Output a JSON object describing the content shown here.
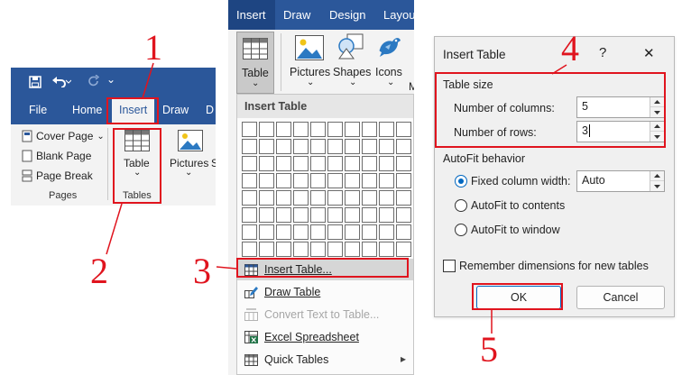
{
  "panel1": {
    "tabs": [
      "File",
      "Home",
      "Insert",
      "Draw",
      "D"
    ],
    "pages_group": {
      "items": [
        "Cover Page",
        "Blank Page",
        "Page Break"
      ],
      "label": "Pages",
      "chevron": "⌄"
    },
    "tables_group": {
      "button": "Table",
      "chevron": "⌄",
      "label": "Tables"
    },
    "pictures_button": "Pictures",
    "clipped_text": "S"
  },
  "panel2": {
    "tabs": [
      "Insert",
      "Draw",
      "Design",
      "Layout"
    ],
    "ribbon": {
      "table": "Table",
      "pictures": "Pictures",
      "shapes": "Shapes",
      "icons": "Icons",
      "clipped": "M",
      "chevron": "⌄"
    },
    "menu": {
      "title": "Insert Table",
      "grid": {
        "columns": 10,
        "rows": 8
      },
      "items": [
        {
          "label": "Insert Table...",
          "highlighted": true,
          "disabled": false,
          "icon": "table-icon"
        },
        {
          "label": "Draw Table",
          "highlighted": false,
          "disabled": false,
          "icon": "pencil-icon"
        },
        {
          "label": "Convert Text to Table...",
          "highlighted": false,
          "disabled": true,
          "icon": "convert-icon"
        },
        {
          "label": "Excel Spreadsheet",
          "highlighted": false,
          "disabled": false,
          "icon": "excel-icon"
        },
        {
          "label": "Quick Tables",
          "highlighted": false,
          "disabled": false,
          "icon": "quick-tables-icon",
          "submenu_arrow": "▸"
        }
      ]
    }
  },
  "dialog": {
    "title": "Insert Table",
    "help": "?",
    "close": "✕",
    "table_size": {
      "heading": "Table size",
      "columns_label": "Number of columns:",
      "columns_value": "5",
      "rows_label": "Number of rows:",
      "rows_value": "3"
    },
    "autofit": {
      "heading": "AutoFit behavior",
      "fixed_label": "Fixed column width:",
      "fixed_value": "Auto",
      "contents_label": "AutoFit to contents",
      "window_label": "AutoFit to window",
      "selected": "fixed"
    },
    "remember_label": "Remember dimensions for new tables",
    "remember_checked": false,
    "ok": "OK",
    "cancel": "Cancel"
  },
  "annotations": {
    "step1": "1",
    "step2": "2",
    "step3": "3",
    "step4": "4",
    "step5": "5",
    "color": "#e0141e"
  },
  "colors": {
    "ribbon_blue": "#2b579a",
    "accent": "#0067c0"
  }
}
